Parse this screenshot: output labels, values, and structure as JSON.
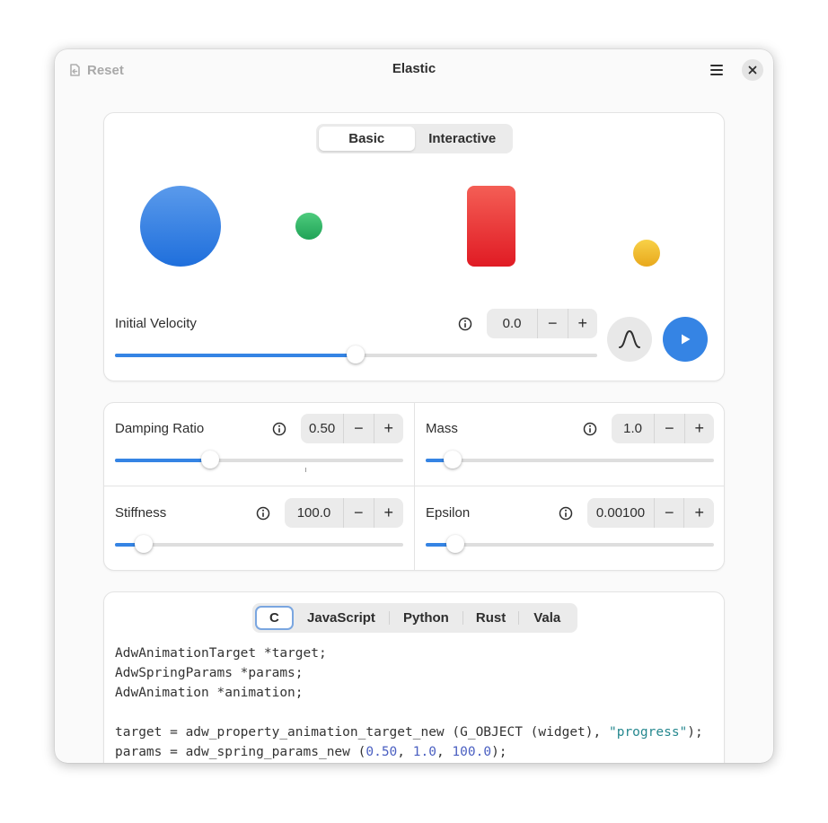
{
  "window": {
    "title": "Elastic",
    "reset_label": "Reset"
  },
  "mode_tabs": [
    {
      "label": "Basic",
      "active": true
    },
    {
      "label": "Interactive",
      "active": false
    }
  ],
  "initial_velocity": {
    "label": "Initial Velocity",
    "value": "0.0",
    "slider_fraction": 0.5
  },
  "damping_ratio": {
    "label": "Damping Ratio",
    "value": "0.50",
    "slider_fraction": 0.33
  },
  "mass": {
    "label": "Mass",
    "value": "1.0",
    "slider_fraction": 0.095
  },
  "stiffness": {
    "label": "Stiffness",
    "value": "100.0",
    "slider_fraction": 0.1
  },
  "epsilon": {
    "label": "Epsilon",
    "value": "0.00100",
    "slider_fraction": 0.105
  },
  "language_tabs": [
    {
      "label": "C",
      "active": true
    },
    {
      "label": "JavaScript",
      "active": false
    },
    {
      "label": "Python",
      "active": false
    },
    {
      "label": "Rust",
      "active": false
    },
    {
      "label": "Vala",
      "active": false
    }
  ],
  "code": {
    "line1": "AdwAnimationTarget *target;",
    "line2": "AdwSpringParams *params;",
    "line3": "AdwAnimation *animation;",
    "line5_a": "target = adw_property_animation_target_new (G_OBJECT (widget), ",
    "line5_str": "\"progress\"",
    "line5_b": ");",
    "line6_a": "params = adw_spring_params_new (",
    "line6_n1": "0.50",
    "line6_s1": ", ",
    "line6_n2": "1.0",
    "line6_s2": ", ",
    "line6_n3": "100.0",
    "line6_b": ");"
  },
  "colors": {
    "accent": "#3584e4",
    "blue_ball": "#3584e4",
    "green_ball": "#2ec27e",
    "red_rect": "#e01b24",
    "yellow_ball": "#f6c22b"
  }
}
